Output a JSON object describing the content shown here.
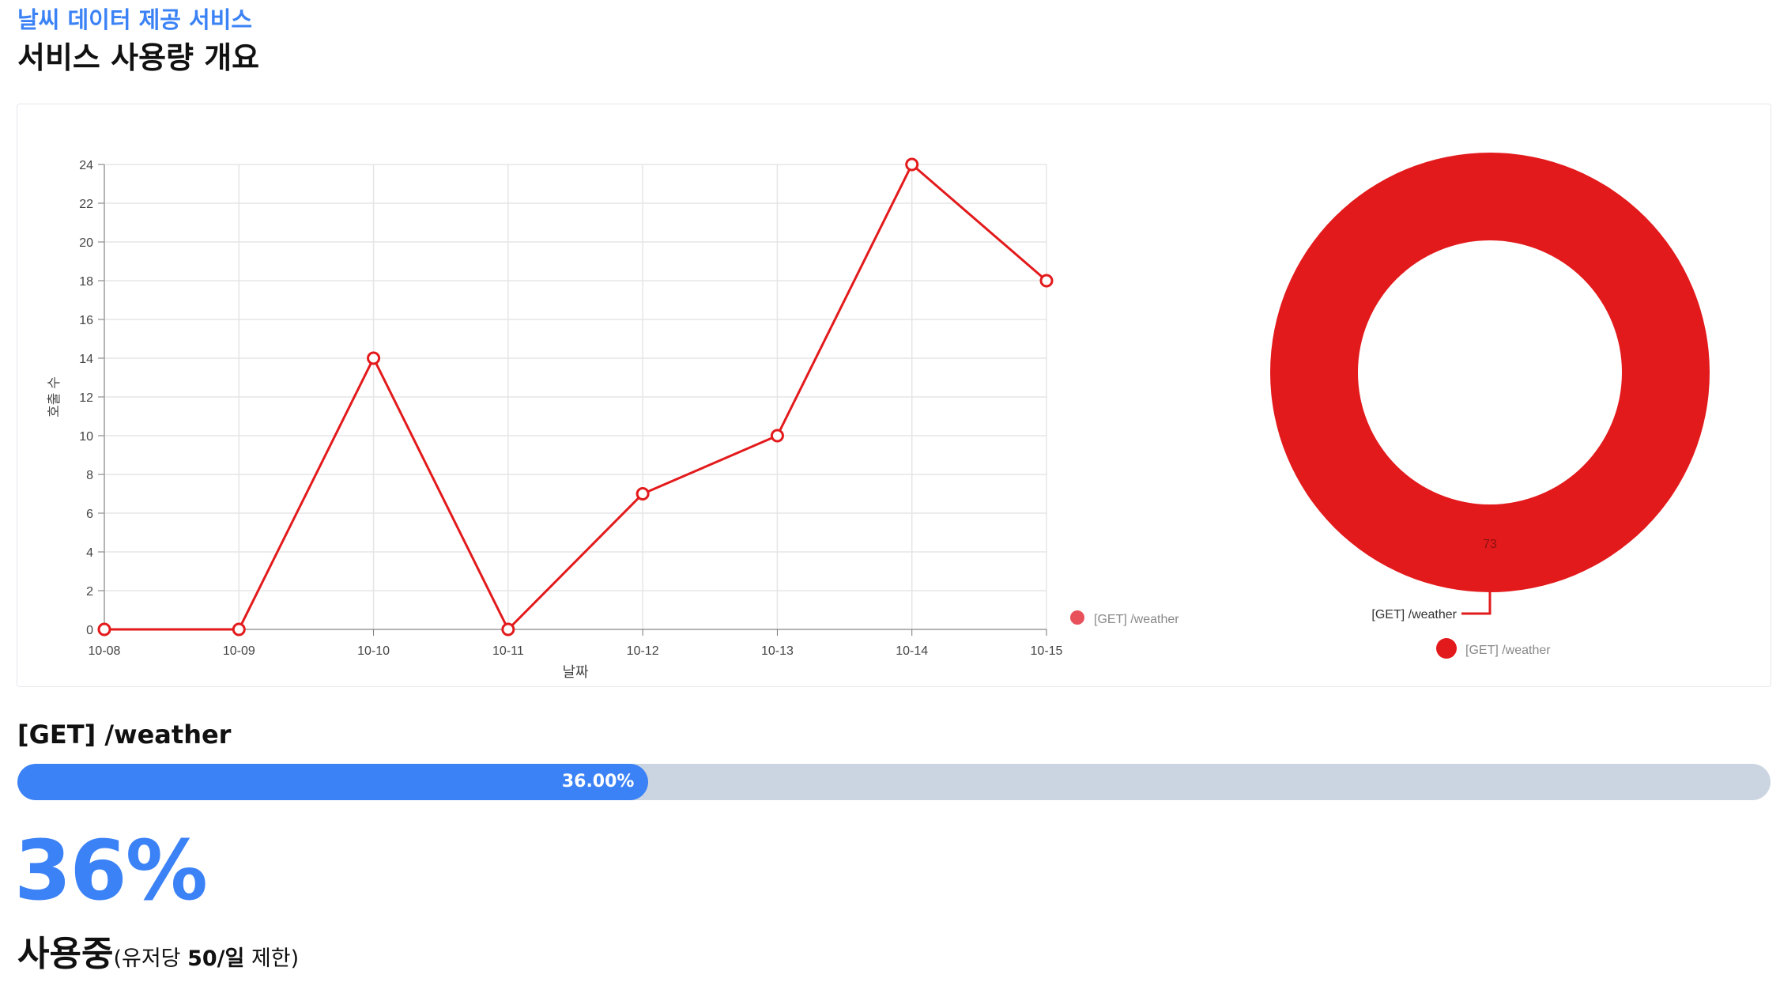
{
  "header": {
    "service_name": "날씨 데이터 제공 서비스",
    "page_title": "서비스 사용량 개요"
  },
  "colors": {
    "accent": "#3b82f6",
    "series": "#e31a1c",
    "track": "#cbd5e1"
  },
  "chart_data": [
    {
      "type": "line",
      "xlabel": "날짜",
      "ylabel": "호출 수",
      "categories": [
        "10-08",
        "10-09",
        "10-10",
        "10-11",
        "10-12",
        "10-13",
        "10-14",
        "10-15"
      ],
      "series": [
        {
          "name": "[GET] /weather",
          "values": [
            0,
            0,
            14,
            0,
            7,
            10,
            24,
            18
          ]
        }
      ],
      "ylim": [
        0,
        24
      ],
      "yticks": [
        0,
        2,
        4,
        6,
        8,
        10,
        12,
        14,
        16,
        18,
        20,
        22,
        24
      ],
      "grid": true,
      "legend": "right-bottom"
    },
    {
      "type": "pie",
      "donut": true,
      "series": [
        {
          "name": "[GET] /weather",
          "value": 73
        }
      ],
      "slice_label": "[GET] /weather",
      "value_label": "73",
      "legend": "bottom"
    }
  ],
  "endpoint": {
    "title": "[GET] /weather",
    "progress": 36,
    "progress_label": "36.00%",
    "big_percent": "36%"
  },
  "usage": {
    "label": "사용중",
    "note_prefix": "(유저당 ",
    "limit": "50/일",
    "note_suffix": " 제한)"
  }
}
